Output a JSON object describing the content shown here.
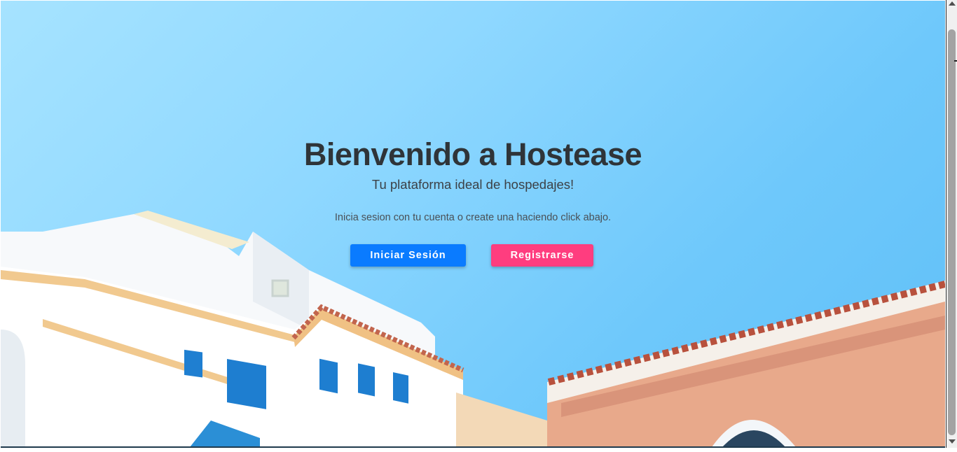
{
  "hero": {
    "title": "Bienvenido a Hostease",
    "subtitle": "Tu plataforma ideal de hospedajes!",
    "hint": "Inicia sesion con tu cuenta o create una haciendo click abajo."
  },
  "buttons": {
    "login_label": "Iniciar Sesión",
    "register_label": "Registrarse"
  },
  "colors": {
    "login_button": "#0a7bff",
    "register_button": "#ff3d7f",
    "title_text": "#2f3438",
    "sky": "#8fd8ff"
  },
  "background_image": "sky-with-white-mediterranean-buildings"
}
